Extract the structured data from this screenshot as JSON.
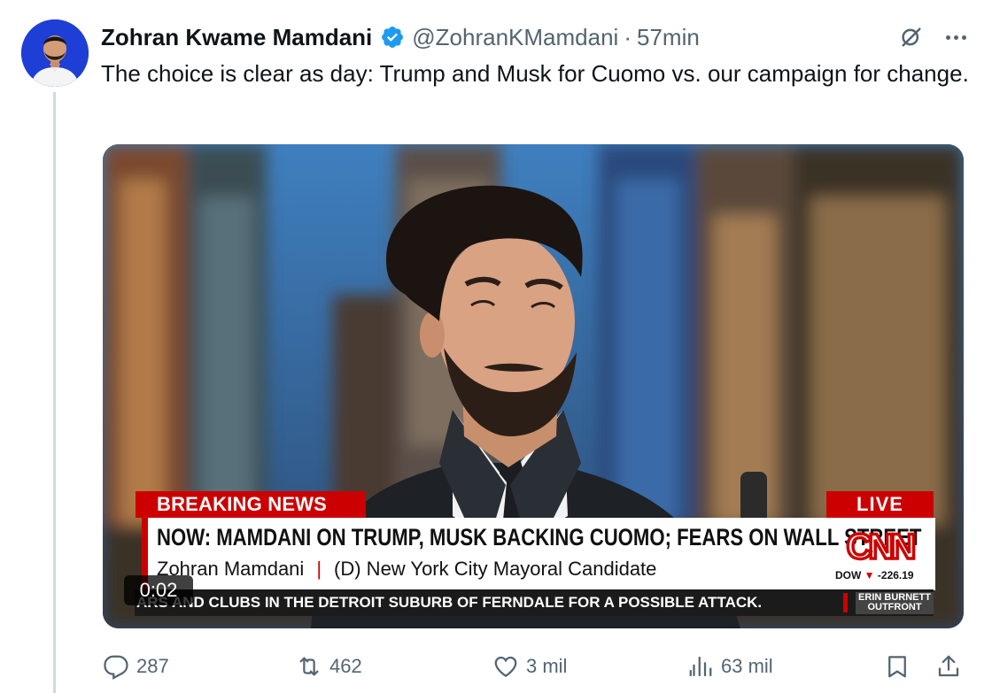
{
  "tweet": {
    "author_name": "Zohran Kwame Mamdani",
    "handle": "@ZohranKMamdani",
    "separator": "·",
    "time": "57min",
    "text": "The choice is clear as day: Trump and Musk for Cuomo vs. our campaign for change."
  },
  "video": {
    "breaking_label": "BREAKING NEWS",
    "live_label": "LIVE",
    "headline": "NOW: MAMDANI ON TRUMP, MUSK BACKING CUOMO; FEARS ON WALL STREET",
    "guest_name": "Zohran Mamdani",
    "guest_title": "(D) New York City Mayoral Candidate",
    "network": "CNN",
    "dow_label": "DOW",
    "dow_value": "-226.19",
    "ticker": "ARS AND CLUBS IN THE DETROIT SUBURB OF FERNDALE FOR A POSSIBLE ATTACK.",
    "show_name_1": "ERIN BURNETT",
    "show_name_2": "OUTFRONT",
    "elapsed": "0:02"
  },
  "actions": {
    "replies": "287",
    "reposts": "462",
    "likes": "3 mil",
    "views": "63 mil"
  },
  "colors": {
    "verified": "#1d9bf0",
    "secondary_text": "#536471",
    "cnn_red": "#cc0000"
  },
  "icons": [
    "verified-badge-icon",
    "grok-icon",
    "more-icon",
    "reply-icon",
    "repost-icon",
    "like-icon",
    "views-icon",
    "bookmark-icon",
    "share-icon"
  ]
}
